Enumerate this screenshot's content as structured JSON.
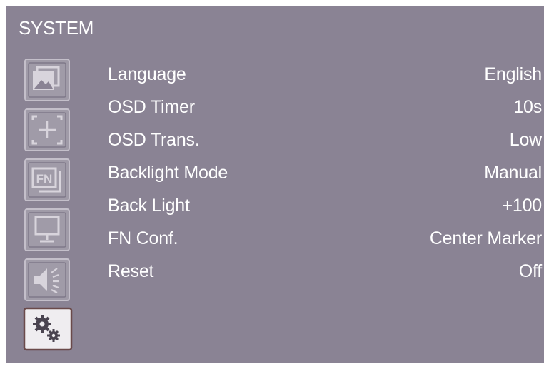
{
  "osd": {
    "title": "SYSTEM",
    "tabs": [
      {
        "icon": "picture-icon",
        "active": false
      },
      {
        "icon": "marker-icon",
        "active": false
      },
      {
        "icon": "fn-icon",
        "active": false
      },
      {
        "icon": "display-icon",
        "active": false
      },
      {
        "icon": "audio-icon",
        "active": false
      },
      {
        "icon": "system-gears-icon",
        "active": true
      }
    ],
    "items": [
      {
        "label": "Language",
        "value": "English"
      },
      {
        "label": "OSD Timer",
        "value": "10s"
      },
      {
        "label": "OSD Trans.",
        "value": "Low"
      },
      {
        "label": "Backlight Mode",
        "value": "Manual"
      },
      {
        "label": "Back Light",
        "value": "+100"
      },
      {
        "label": "FN Conf.",
        "value": "Center Marker"
      },
      {
        "label": "Reset",
        "value": "Off"
      }
    ]
  },
  "colors": {
    "background": "#8a8394",
    "text": "#ffffff",
    "icon_fill": "#9d98a5",
    "icon_border": "#bdb8c4",
    "active_border": "#6a4a4a"
  }
}
